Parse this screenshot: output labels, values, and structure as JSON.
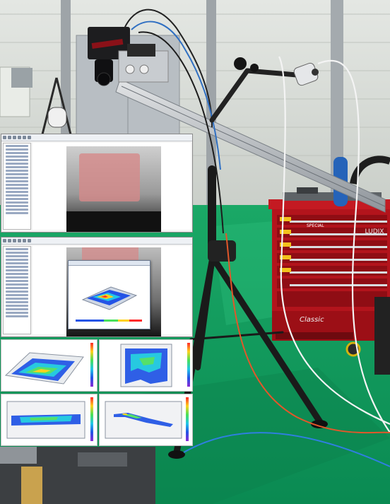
{
  "scene": {
    "description_tags": [
      "warehouse-wall",
      "camera-rig",
      "tool-cabinet",
      "tripod",
      "green-floor"
    ],
    "cabinet_brand_text": "LUDIX",
    "cabinet_model_text": "Classic",
    "cabinet_label_text": "SPECIAL"
  },
  "colors": {
    "floor_green": "#0f9b5e",
    "cabinet_red": "#b3141c",
    "wall_gray": "#d9dcd8",
    "rail_silver": "#b9bdc2",
    "highlight_pink": "#d68a8a"
  },
  "overlays": {
    "software_windows": 2,
    "result_panels": 4
  }
}
